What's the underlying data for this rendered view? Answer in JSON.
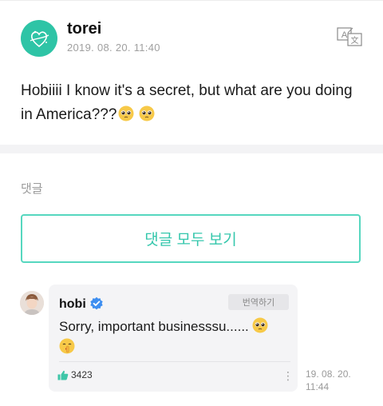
{
  "post": {
    "username": "torei",
    "timestamp": "2019. 08. 20. 11:40",
    "body": "Hobiiii I know it's a secret, but what are you doing in America???",
    "icons": {
      "avatar": "heart-logo-avatar",
      "translate": "translate-icon",
      "emoji": "pleading-face-emoji"
    },
    "accent_color": "#2ec4a6"
  },
  "comments_section": {
    "label": "댓글",
    "view_all_label": "댓글 모두 보기",
    "button_color": "#56d7bf"
  },
  "comment": {
    "username": "hobi",
    "translate_label": "번역하기",
    "text": "Sorry, important businesssu......",
    "like_count": "3423",
    "more_label": "⋮",
    "time_line1": "19. 08. 20.",
    "time_line2": "11:44",
    "icons": {
      "verified": "verified-badge-icon",
      "like": "thumbs-up-icon",
      "emoji1": "pleading-face-emoji",
      "emoji2": "shushing-face-emoji"
    }
  }
}
